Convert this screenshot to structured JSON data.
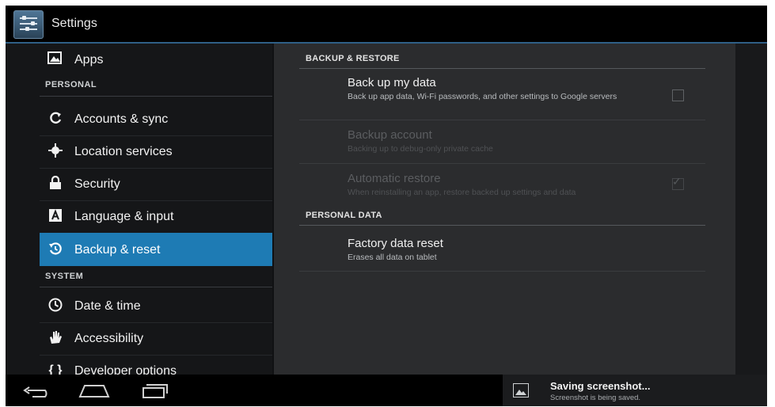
{
  "app": {
    "title": "Settings",
    "icon": "settings-sliders-icon"
  },
  "sidebar": {
    "items": [
      {
        "label": "Apps",
        "icon": "apps-icon"
      },
      {
        "label": "Accounts & sync",
        "icon": "sync-icon"
      },
      {
        "label": "Location services",
        "icon": "location-icon"
      },
      {
        "label": "Security",
        "icon": "lock-icon"
      },
      {
        "label": "Language & input",
        "icon": "language-icon"
      },
      {
        "label": "Backup & reset",
        "icon": "backup-icon",
        "selected": true
      },
      {
        "label": "Date & time",
        "icon": "clock-icon"
      },
      {
        "label": "Accessibility",
        "icon": "hand-icon"
      },
      {
        "label": "Developer options",
        "icon": "braces-icon"
      }
    ],
    "headers": {
      "personal": "PERSONAL",
      "system": "SYSTEM"
    }
  },
  "content": {
    "backup_header": "BACKUP & RESTORE",
    "backup_data": {
      "title": "Back up my data",
      "summary": "Back up app data, Wi-Fi passwords, and other settings to Google servers",
      "checked": false
    },
    "backup_account": {
      "title": "Backup account",
      "summary": "Backing up to debug-only private cache",
      "enabled": false
    },
    "auto_restore": {
      "title": "Automatic restore",
      "summary": "When reinstalling an app, restore backed up settings and data",
      "checked": true,
      "enabled": false
    },
    "personal_header": "PERSONAL DATA",
    "factory_reset": {
      "title": "Factory data reset",
      "summary": "Erases all data on tablet"
    }
  },
  "notification": {
    "title": "Saving screenshot...",
    "subtitle": "Screenshot is being saved.",
    "icon": "image-icon"
  },
  "navbar": {
    "back": "back-icon",
    "home": "home-icon",
    "recents": "recents-icon"
  },
  "colors": {
    "accent": "#1e7bb4",
    "background": "#2b2c2e"
  }
}
